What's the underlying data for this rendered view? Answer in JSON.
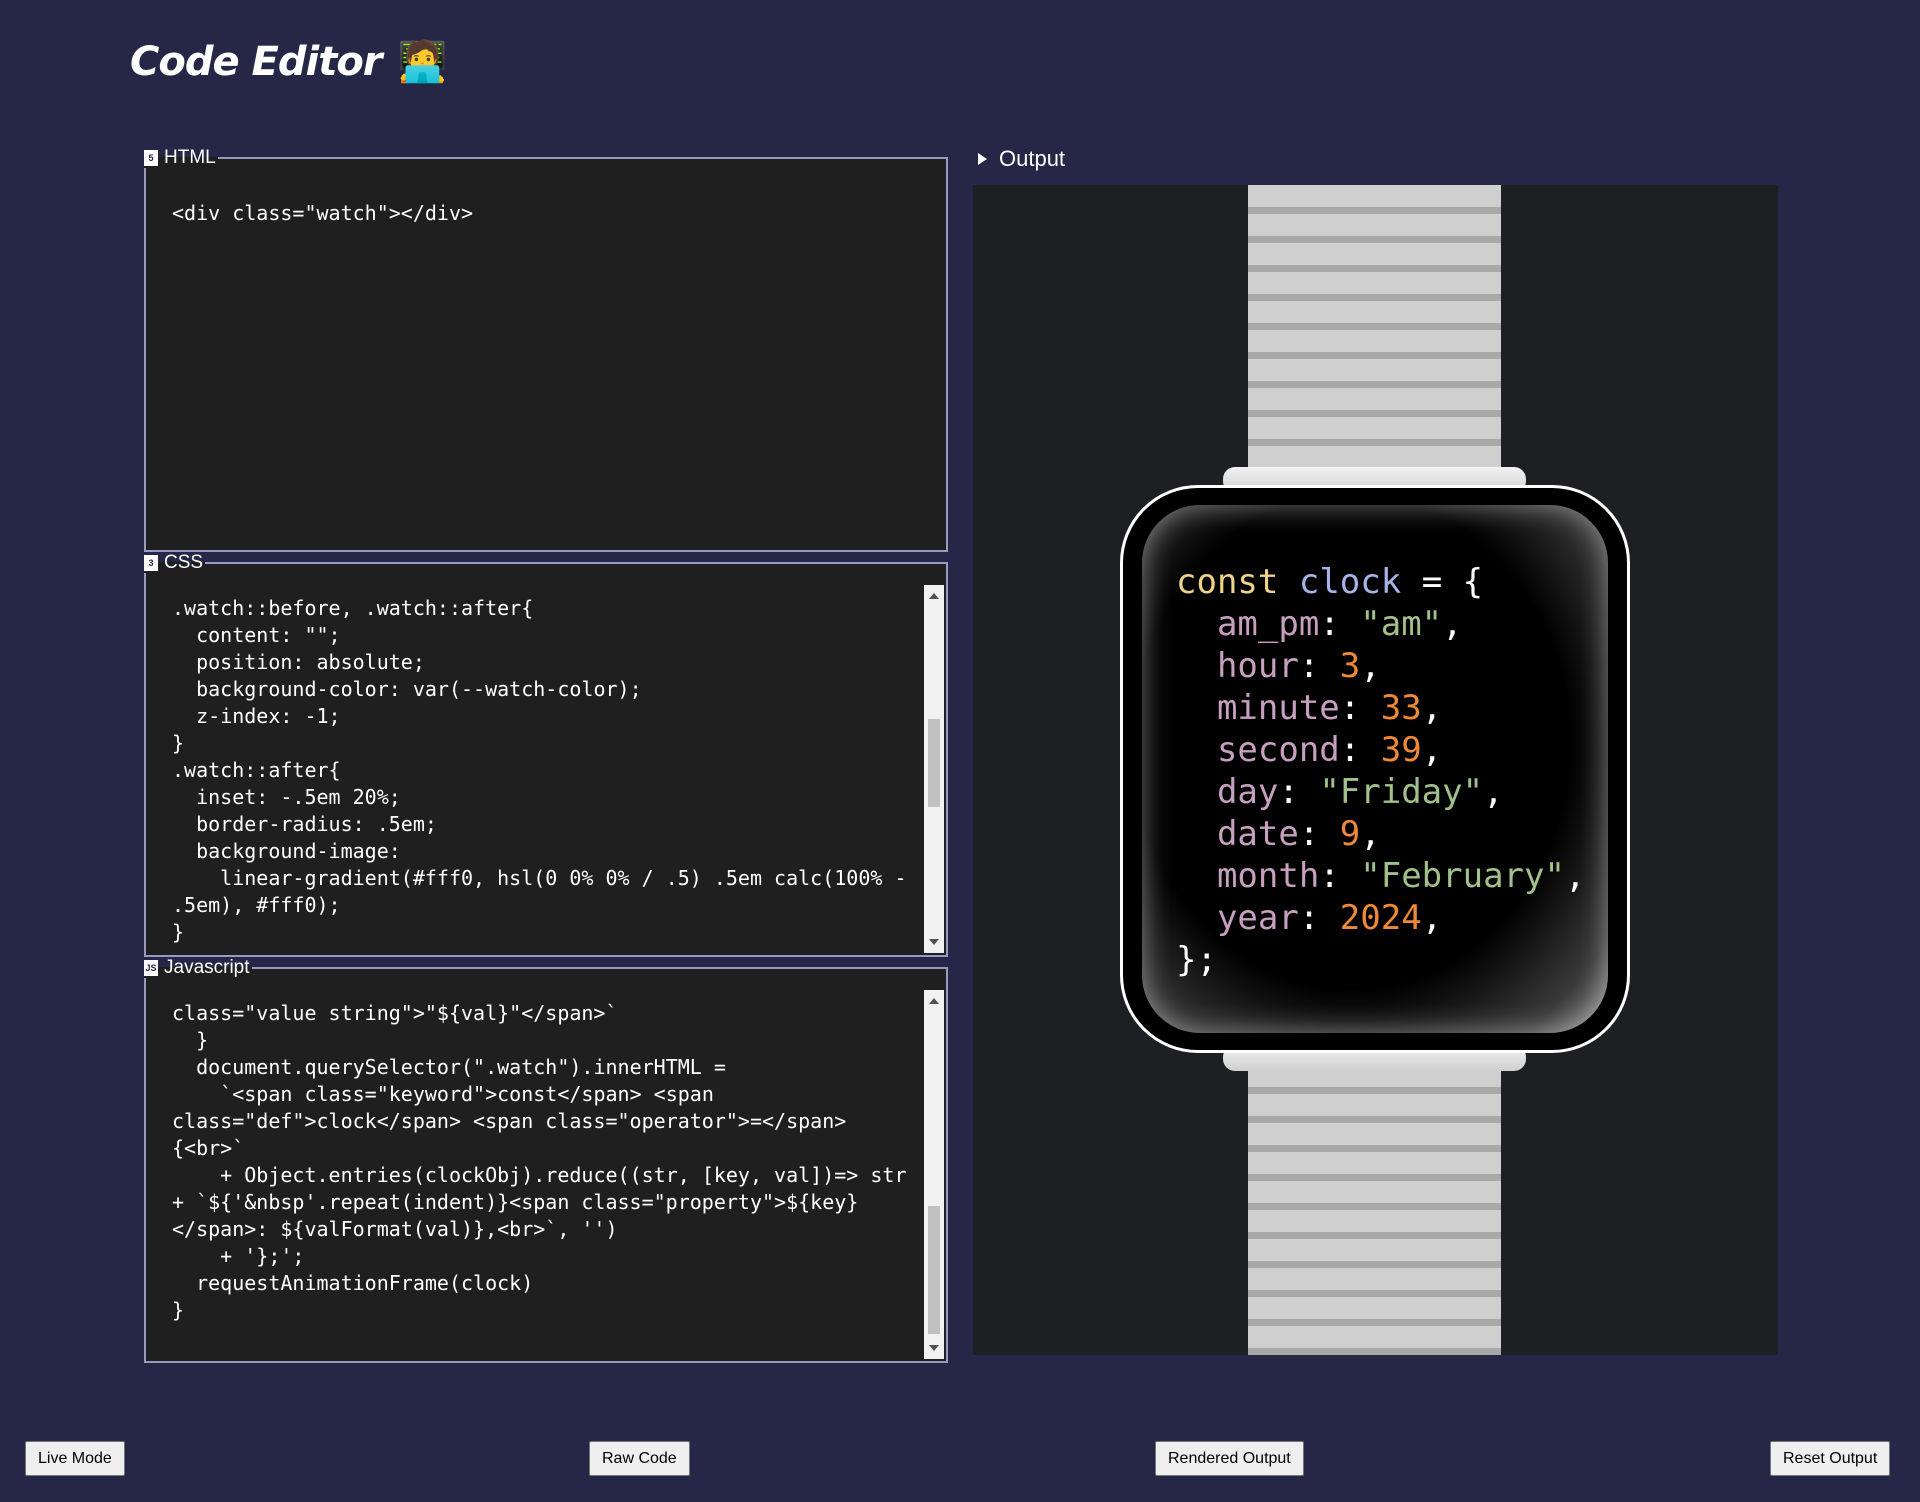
{
  "header": {
    "title": "Code Editor",
    "emoji": "🧑‍💻"
  },
  "html_panel": {
    "legend": "HTML",
    "icon": "html5-icon",
    "code": "<div class=\"watch\"></div>"
  },
  "css_panel": {
    "legend": "CSS",
    "icon": "css3-icon",
    "code": ".watch::before, .watch::after{\n  content: \"\";\n  position: absolute;\n  background-color: var(--watch-color);\n  z-index: -1;\n}\n.watch::after{\n  inset: -.5em 20%;\n  border-radius: .5em;\n  background-image:\n    linear-gradient(#fff0, hsl(0 0% 0% / .5) .5em calc(100% - .5em), #fff0);\n}\n.watch::before{"
  },
  "js_panel": {
    "legend": "Javascript",
    "icon": "js-icon",
    "code": "class=\"value string\">\"${val}\"</span>`\n  }\n  document.querySelector(\".watch\").innerHTML =\n    `<span class=\"keyword\">const</span> <span class=\"def\">clock</span> <span class=\"operator\">=</span> {<br>`\n    + Object.entries(clockObj).reduce((str, [key, val])=> str + `${'&nbsp'.repeat(indent)}<span class=\"property\">${key}</span>: ${valFormat(val)},<br>`, '')\n    + '};';\n  requestAnimationFrame(clock)\n}"
  },
  "output": {
    "label": "Output",
    "watch": {
      "keyword": "const",
      "def": "clock",
      "operator": "=",
      "open": "{",
      "close": "};",
      "entries": [
        {
          "key": "am_pm",
          "value": "\"am\"",
          "type": "string"
        },
        {
          "key": "hour",
          "value": "3",
          "type": "number"
        },
        {
          "key": "minute",
          "value": "33",
          "type": "number"
        },
        {
          "key": "second",
          "value": "39",
          "type": "number"
        },
        {
          "key": "day",
          "value": "\"Friday\"",
          "type": "string"
        },
        {
          "key": "date",
          "value": "9",
          "type": "number"
        },
        {
          "key": "month",
          "value": "\"February\"",
          "type": "string"
        },
        {
          "key": "year",
          "value": "2024",
          "type": "number"
        }
      ]
    }
  },
  "buttons": {
    "live_mode": "Live Mode",
    "raw_code": "Raw Code",
    "rendered_output": "Rendered Output",
    "reset_output": "Reset Output"
  },
  "colors": {
    "page_bg": "#262646",
    "editor_bg": "#1f1f1f",
    "keyword": "#f0d28a",
    "def": "#a8b4e8",
    "property": "#c7a0bf",
    "string": "#a2c08a",
    "number": "#ee8a36"
  }
}
